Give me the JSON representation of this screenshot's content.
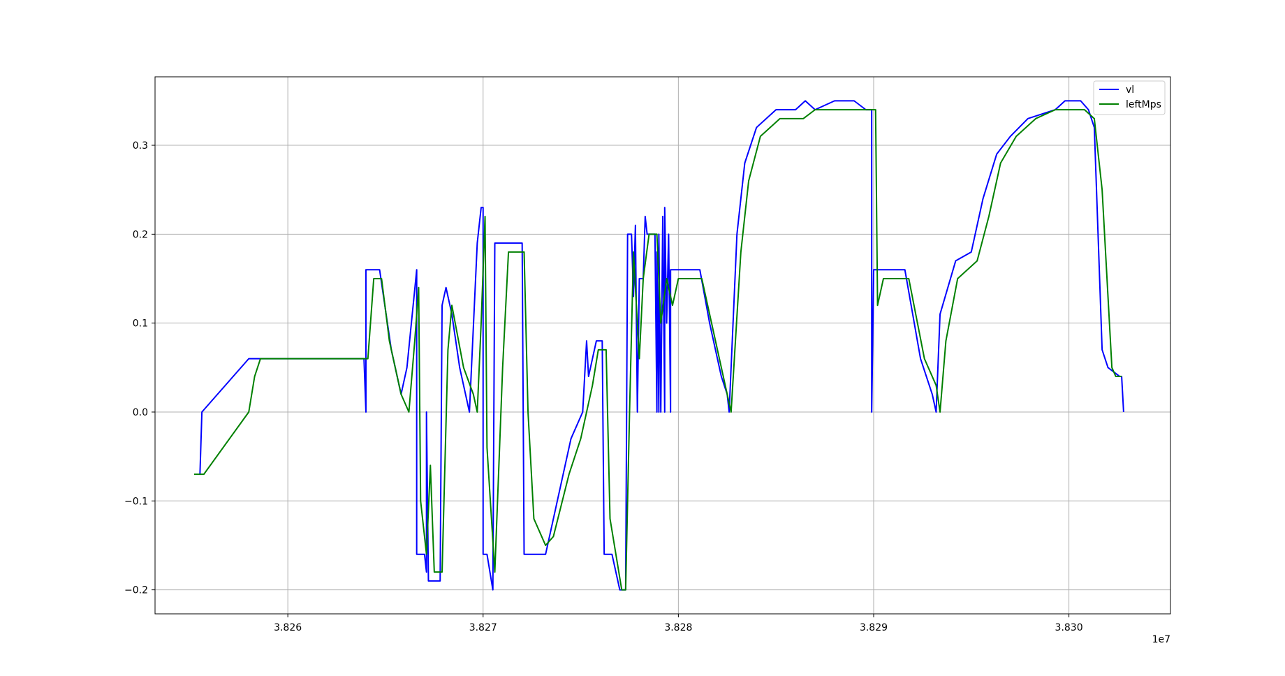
{
  "chart_data": {
    "type": "line",
    "title": "",
    "xlabel": "",
    "ylabel": "",
    "x_offset_label": "1e7",
    "xlim": [
      38253200,
      38305200
    ],
    "ylim": [
      -0.227,
      0.377
    ],
    "x_ticks": [
      38260000,
      38270000,
      38280000,
      38290000,
      38300000
    ],
    "x_tick_labels": [
      "3.826",
      "3.827",
      "3.828",
      "3.829",
      "3.830"
    ],
    "y_ticks": [
      -0.2,
      -0.1,
      0.0,
      0.1,
      0.2,
      0.3
    ],
    "y_tick_labels": [
      "−0.2",
      "−0.1",
      "0.0",
      "0.1",
      "0.2",
      "0.3"
    ],
    "grid": true,
    "legend_position": "top-right",
    "series": [
      {
        "name": "vl",
        "color": "#0000ff",
        "points": [
          [
            38255500,
            -0.07
          ],
          [
            38255600,
            0.0
          ],
          [
            38258000,
            0.06
          ],
          [
            38263900,
            0.06
          ],
          [
            38264000,
            0.0
          ],
          [
            38264000,
            0.16
          ],
          [
            38264700,
            0.16
          ],
          [
            38265300,
            0.07
          ],
          [
            38265800,
            0.02
          ],
          [
            38266100,
            0.05
          ],
          [
            38266600,
            0.16
          ],
          [
            38266600,
            -0.16
          ],
          [
            38267000,
            -0.16
          ],
          [
            38267100,
            -0.18
          ],
          [
            38267100,
            0.0
          ],
          [
            38267200,
            -0.19
          ],
          [
            38267800,
            -0.19
          ],
          [
            38267900,
            0.12
          ],
          [
            38268100,
            0.14
          ],
          [
            38268400,
            0.11
          ],
          [
            38268800,
            0.05
          ],
          [
            38269300,
            0.0
          ],
          [
            38269700,
            0.19
          ],
          [
            38269900,
            0.23
          ],
          [
            38270000,
            0.23
          ],
          [
            38270000,
            -0.16
          ],
          [
            38270200,
            -0.16
          ],
          [
            38270500,
            -0.2
          ],
          [
            38270600,
            0.19
          ],
          [
            38272000,
            0.19
          ],
          [
            38272100,
            -0.16
          ],
          [
            38273200,
            -0.16
          ],
          [
            38273800,
            -0.1
          ],
          [
            38274500,
            -0.03
          ],
          [
            38275100,
            0.0
          ],
          [
            38275300,
            0.08
          ],
          [
            38275400,
            0.04
          ],
          [
            38275800,
            0.08
          ],
          [
            38276100,
            0.08
          ],
          [
            38276200,
            -0.16
          ],
          [
            38276600,
            -0.16
          ],
          [
            38277000,
            -0.2
          ],
          [
            38277300,
            -0.2
          ],
          [
            38277400,
            0.2
          ],
          [
            38277600,
            0.2
          ],
          [
            38277700,
            0.13
          ],
          [
            38277800,
            0.21
          ],
          [
            38277900,
            0.0
          ],
          [
            38278000,
            0.15
          ],
          [
            38278200,
            0.15
          ],
          [
            38278300,
            0.22
          ],
          [
            38278400,
            0.2
          ],
          [
            38278800,
            0.2
          ],
          [
            38278900,
            0.0
          ],
          [
            38278900,
            0.18
          ],
          [
            38279000,
            0.0
          ],
          [
            38279000,
            0.2
          ],
          [
            38279100,
            0.0
          ],
          [
            38279200,
            0.22
          ],
          [
            38279300,
            0.0
          ],
          [
            38279300,
            0.23
          ],
          [
            38279400,
            0.1
          ],
          [
            38279500,
            0.2
          ],
          [
            38279600,
            0.0
          ],
          [
            38279600,
            0.16
          ],
          [
            38281100,
            0.16
          ],
          [
            38281600,
            0.1
          ],
          [
            38282200,
            0.04
          ],
          [
            38282500,
            0.02
          ],
          [
            38282600,
            0.0
          ],
          [
            38283000,
            0.2
          ],
          [
            38283400,
            0.28
          ],
          [
            38284000,
            0.32
          ],
          [
            38285000,
            0.34
          ],
          [
            38286000,
            0.34
          ],
          [
            38286500,
            0.35
          ],
          [
            38287000,
            0.34
          ],
          [
            38288000,
            0.35
          ],
          [
            38289000,
            0.35
          ],
          [
            38289600,
            0.34
          ],
          [
            38289900,
            0.34
          ],
          [
            38289900,
            0.0
          ],
          [
            38290000,
            0.16
          ],
          [
            38291600,
            0.16
          ],
          [
            38292400,
            0.06
          ],
          [
            38293000,
            0.02
          ],
          [
            38293200,
            0.0
          ],
          [
            38293400,
            0.11
          ],
          [
            38294200,
            0.17
          ],
          [
            38295000,
            0.18
          ],
          [
            38295600,
            0.24
          ],
          [
            38296300,
            0.29
          ],
          [
            38297000,
            0.31
          ],
          [
            38297900,
            0.33
          ],
          [
            38299300,
            0.34
          ],
          [
            38299800,
            0.35
          ],
          [
            38300600,
            0.35
          ],
          [
            38301000,
            0.34
          ],
          [
            38301300,
            0.32
          ],
          [
            38301700,
            0.07
          ],
          [
            38302000,
            0.05
          ],
          [
            38302600,
            0.04
          ],
          [
            38302700,
            0.04
          ],
          [
            38302800,
            0.0
          ]
        ]
      },
      {
        "name": "leftMps",
        "color": "#008000",
        "points": [
          [
            38255200,
            -0.07
          ],
          [
            38255700,
            -0.07
          ],
          [
            38258000,
            0.0
          ],
          [
            38258300,
            0.04
          ],
          [
            38258600,
            0.06
          ],
          [
            38263900,
            0.06
          ],
          [
            38264100,
            0.06
          ],
          [
            38264400,
            0.15
          ],
          [
            38264800,
            0.15
          ],
          [
            38265200,
            0.08
          ],
          [
            38265800,
            0.02
          ],
          [
            38266200,
            0.0
          ],
          [
            38266500,
            0.08
          ],
          [
            38266700,
            0.14
          ],
          [
            38266800,
            -0.1
          ],
          [
            38267100,
            -0.16
          ],
          [
            38267300,
            -0.06
          ],
          [
            38267500,
            -0.18
          ],
          [
            38267900,
            -0.18
          ],
          [
            38268200,
            0.07
          ],
          [
            38268400,
            0.12
          ],
          [
            38269000,
            0.05
          ],
          [
            38269500,
            0.02
          ],
          [
            38269700,
            0.0
          ],
          [
            38269900,
            0.1
          ],
          [
            38270100,
            0.22
          ],
          [
            38270200,
            -0.04
          ],
          [
            38270600,
            -0.18
          ],
          [
            38271000,
            0.05
          ],
          [
            38271300,
            0.18
          ],
          [
            38272100,
            0.18
          ],
          [
            38272300,
            0.0
          ],
          [
            38272600,
            -0.12
          ],
          [
            38273200,
            -0.15
          ],
          [
            38273600,
            -0.14
          ],
          [
            38274400,
            -0.07
          ],
          [
            38275000,
            -0.03
          ],
          [
            38275600,
            0.03
          ],
          [
            38275900,
            0.07
          ],
          [
            38276300,
            0.07
          ],
          [
            38276500,
            -0.12
          ],
          [
            38277100,
            -0.2
          ],
          [
            38277300,
            -0.2
          ],
          [
            38277500,
            0.0
          ],
          [
            38277700,
            0.18
          ],
          [
            38278000,
            0.06
          ],
          [
            38278200,
            0.15
          ],
          [
            38278500,
            0.2
          ],
          [
            38278900,
            0.2
          ],
          [
            38279100,
            0.1
          ],
          [
            38279400,
            0.15
          ],
          [
            38279700,
            0.12
          ],
          [
            38280000,
            0.15
          ],
          [
            38281200,
            0.15
          ],
          [
            38281900,
            0.08
          ],
          [
            38282700,
            0.0
          ],
          [
            38283200,
            0.18
          ],
          [
            38283600,
            0.26
          ],
          [
            38284200,
            0.31
          ],
          [
            38285200,
            0.33
          ],
          [
            38286400,
            0.33
          ],
          [
            38287000,
            0.34
          ],
          [
            38289600,
            0.34
          ],
          [
            38290100,
            0.34
          ],
          [
            38290200,
            0.12
          ],
          [
            38290500,
            0.15
          ],
          [
            38291800,
            0.15
          ],
          [
            38292600,
            0.06
          ],
          [
            38293200,
            0.03
          ],
          [
            38293400,
            0.0
          ],
          [
            38293700,
            0.08
          ],
          [
            38294300,
            0.15
          ],
          [
            38295300,
            0.17
          ],
          [
            38295900,
            0.22
          ],
          [
            38296500,
            0.28
          ],
          [
            38297300,
            0.31
          ],
          [
            38298300,
            0.33
          ],
          [
            38299300,
            0.34
          ],
          [
            38300800,
            0.34
          ],
          [
            38301300,
            0.33
          ],
          [
            38301700,
            0.25
          ],
          [
            38302200,
            0.05
          ],
          [
            38302400,
            0.04
          ],
          [
            38302700,
            0.04
          ]
        ]
      }
    ]
  }
}
